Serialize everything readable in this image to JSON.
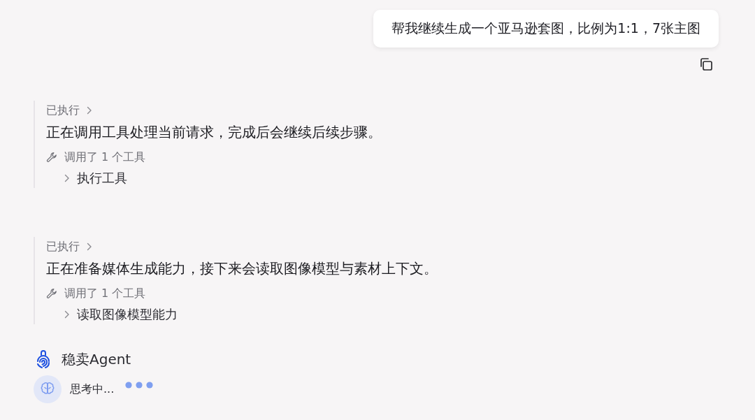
{
  "user_message": {
    "text": "帮我继续生成一个亚马逊套图，比例为1:1，7张主图"
  },
  "steps": [
    {
      "status": "已执行",
      "expanded": false,
      "message": "正在调用工具处理当前请求，完成后会继续后续步骤。",
      "tools_summary": "调用了 1 个工具",
      "tools": [
        {
          "name": "执行工具",
          "expanded": false
        }
      ]
    },
    {
      "status": "已执行",
      "expanded": false,
      "message": "正在准备媒体生成能力，接下来会读取图像模型与素材上下文。",
      "tools_summary": "调用了 1 个工具",
      "tools": [
        {
          "name": "读取图像模型能力",
          "expanded": false
        }
      ]
    }
  ],
  "agent": {
    "name": "稳卖Agent",
    "status": "思考中..."
  }
}
